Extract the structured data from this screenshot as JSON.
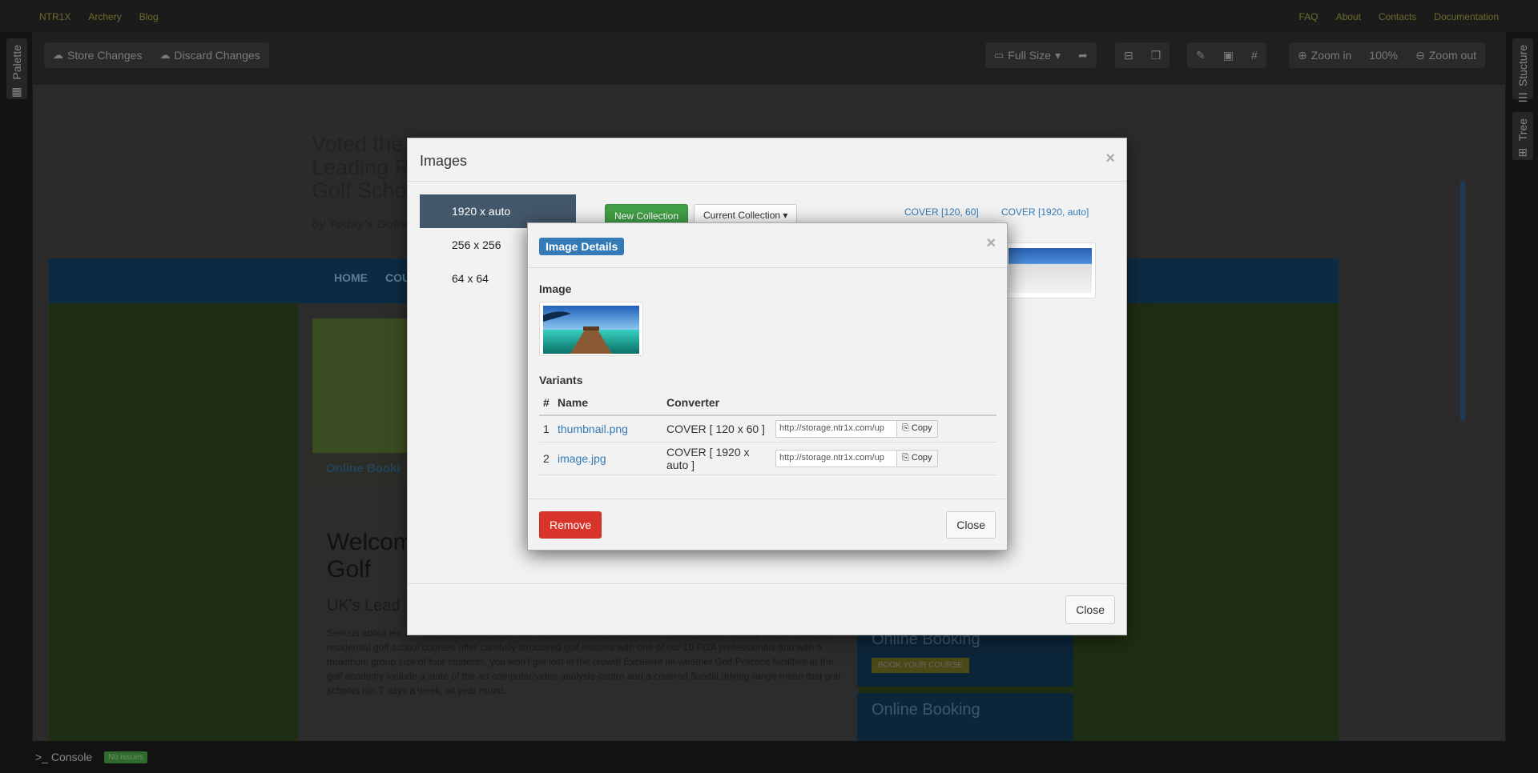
{
  "topnav": {
    "left": [
      "NTR1X",
      "Archery",
      "Blog"
    ],
    "right": [
      "FAQ",
      "About",
      "Contacts",
      "Documentation"
    ]
  },
  "sidepanels": {
    "left_tab": "Palette",
    "right_tabs": [
      "Stucture",
      "Tree"
    ]
  },
  "toolbar": {
    "store": "Store Changes",
    "discard": "Discard Changes",
    "size": "Full Size",
    "zoom_in": "Zoom in",
    "zoom_level": "100%",
    "zoom_out": "Zoom out"
  },
  "site": {
    "header_lines": [
      "Voted the",
      "Leading R",
      "Golf Scho"
    ],
    "tagline": "by Today's Golfe",
    "nav": [
      "HOME",
      "COURS"
    ],
    "booking": "Online Booki",
    "welcome_lines": [
      "Welcom",
      "Golf"
    ],
    "uk": "UK's Lead",
    "para": "Serious about lea James Andrews School of Golf at Sedlescombe Golf Course in East Sussex is the place for you! Our residential golf school courses offer carefully structured golf lessons with one of our 10 PGA professionals and with a maximum group size of four students, you won't get lost in the crowd! Excellent all-weather Golf Practice facilities at the golf academy include a state of the art computer/video analysis centre and a covered floodlit driving range mean that golf schools run 7 days a week, all year round.",
    "promo1_title": "Online Booking",
    "promo1_btn": "BOOK YOUR COURSE",
    "promo2_title": "Online Booking"
  },
  "images_modal": {
    "title": "Images",
    "sizes": [
      "1920 x auto",
      "256 x 256",
      "64 x 64"
    ],
    "active_size": "1920 x auto",
    "new_collection": "New Collection",
    "current_collection": "Current Collection",
    "cover_links": [
      "COVER [120, 60]",
      "COVER [1920, auto]"
    ],
    "close": "Close"
  },
  "details_modal": {
    "title": "Image Details",
    "image_label": "Image",
    "variants_label": "Variants",
    "columns": [
      "#",
      "Name",
      "Converter"
    ],
    "rows": [
      {
        "num": "1",
        "name": "thumbnail.png",
        "converter": "COVER [ 120 x 60 ]",
        "url": "http://storage.ntr1x.com/up",
        "copy": "Copy"
      },
      {
        "num": "2",
        "name": "image.jpg",
        "converter": "COVER [ 1920 x auto ]",
        "url": "http://storage.ntr1x.com/up",
        "copy": "Copy"
      }
    ],
    "remove": "Remove",
    "close": "Close"
  },
  "console": {
    "label": ">_ Console",
    "badge": "No issues"
  }
}
